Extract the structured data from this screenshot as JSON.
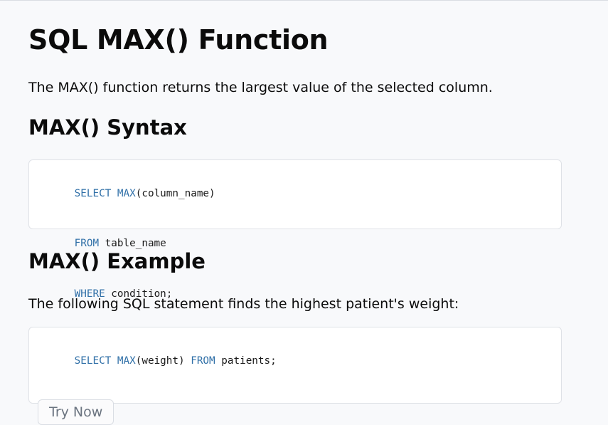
{
  "page": {
    "title": "SQL MAX() Function",
    "intro": "The MAX() function returns the largest value of the selected column.",
    "syntax_heading": "MAX() Syntax",
    "syntax_code": [
      [
        {
          "t": "SELECT",
          "kw": true
        },
        {
          "t": " ",
          "kw": false
        },
        {
          "t": "MAX",
          "kw": true
        },
        {
          "t": "(column_name)",
          "kw": false
        }
      ],
      [
        {
          "t": "FROM",
          "kw": true
        },
        {
          "t": " table_name",
          "kw": false
        }
      ],
      [
        {
          "t": "WHERE",
          "kw": true
        },
        {
          "t": " condition;",
          "kw": false
        }
      ]
    ],
    "example_heading": "MAX() Example",
    "example_text": "The following SQL statement finds the highest patient's weight:",
    "example_code": [
      [
        {
          "t": "SELECT",
          "kw": true
        },
        {
          "t": " ",
          "kw": false
        },
        {
          "t": "MAX",
          "kw": true
        },
        {
          "t": "(weight) ",
          "kw": false
        },
        {
          "t": "FROM",
          "kw": true
        },
        {
          "t": " patients;",
          "kw": false
        }
      ]
    ],
    "try_button_label": "Try Now"
  },
  "colors": {
    "background": "#f8f9fb",
    "keyword": "#2f6fa7",
    "code_box_bg": "#ffffff",
    "border": "#dfe2e7"
  }
}
